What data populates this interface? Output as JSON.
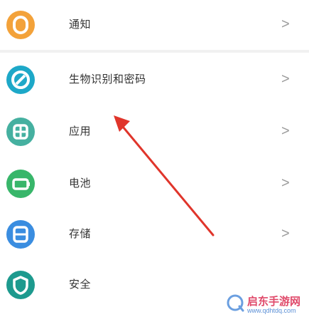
{
  "colors": {
    "notifications_icon": "#f3a23a",
    "privacy_icon": "#1da8c8",
    "apps_icon": "#45b0a0",
    "battery_icon": "#38b66a",
    "storage_icon": "#3a8de0",
    "security_icon": "#1d9a8e",
    "arrow": "#e0352b"
  },
  "settings": {
    "items": [
      {
        "label": "通知",
        "icon": "bell-icon"
      },
      {
        "label": "生物识别和密码",
        "icon": "lock-icon"
      },
      {
        "label": "应用",
        "icon": "apps-icon"
      },
      {
        "label": "电池",
        "icon": "battery-icon"
      },
      {
        "label": "存储",
        "icon": "storage-icon"
      },
      {
        "label": "安全",
        "icon": "shield-icon"
      }
    ]
  },
  "watermark": {
    "title": "启东手游网",
    "url": "www.qdhtdq.com"
  }
}
